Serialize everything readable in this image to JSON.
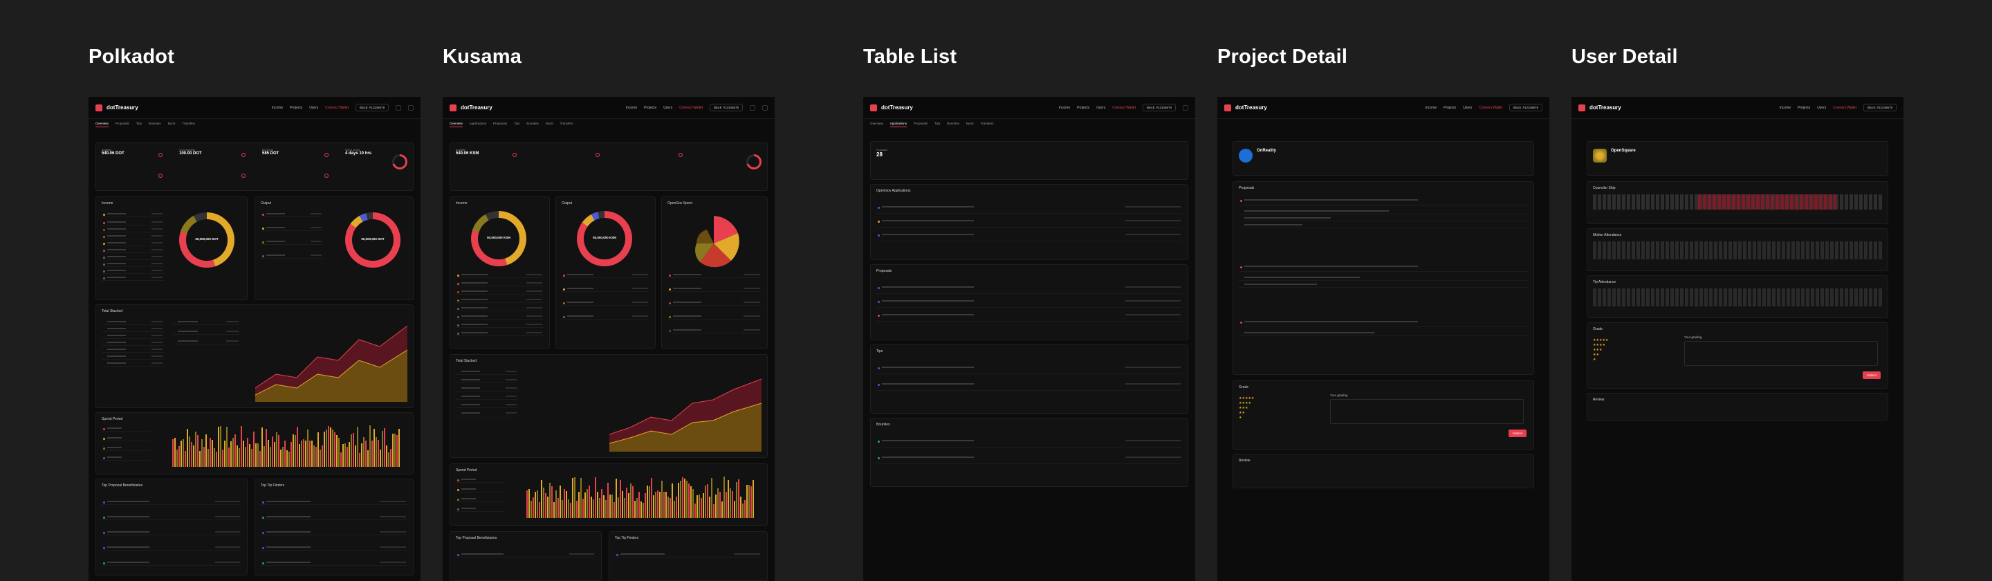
{
  "panels": [
    {
      "title": "Polkadot"
    },
    {
      "title": "Kusama"
    },
    {
      "title": "Table List"
    },
    {
      "title": "Project Detail"
    },
    {
      "title": "User Detail"
    }
  ],
  "app": {
    "logo_text": "dotTreasury",
    "nav": [
      "Income",
      "Projects",
      "Users",
      "Connect Wallet"
    ],
    "wallet": "Block: #12345678"
  },
  "polkadot": {
    "tabs": [
      "Overview",
      "Proposals",
      "Tips",
      "Bounties",
      "Burnt",
      "Transfers"
    ],
    "stats": [
      {
        "label": "Available",
        "value": "540.06 DOT"
      },
      {
        "label": "To be awarded",
        "value": "100.00 DOT"
      },
      {
        "label": "Burnt total",
        "value": "585 DOT"
      },
      {
        "label": "Spend period",
        "value": "4 days 10 hrs"
      }
    ],
    "cards": [
      "Income",
      "Output",
      "Total Stacked",
      "Spend Period",
      "Top Proposal Beneficiaries",
      "Top Tip Finders"
    ],
    "donut_value": "50,000,000 DOT"
  },
  "kusama": {
    "tabs": [
      "Overview",
      "Applications",
      "Proposals",
      "Tips",
      "Bounties",
      "Burnt",
      "Transfers"
    ],
    "cards": [
      "Income",
      "Output",
      "OpenGov Spent",
      "Total Stacked",
      "Spend Period",
      "Top Proposal Beneficiaries",
      "Top Tip Finders"
    ],
    "donut_value": "50,000,000 KSM"
  },
  "table_list": {
    "sections": [
      "OpenGov Applications",
      "Proposals",
      "Tips",
      "Bounties"
    ],
    "count": "28"
  },
  "project_detail": {
    "name": "OnReality",
    "section": "Proposals",
    "grade_label": "Grade",
    "your_grade": "Your grading",
    "submit": "Submit",
    "review": "Review"
  },
  "user_detail": {
    "name": "OpenSquare",
    "sections": [
      "Councilor Ship",
      "Motion Attendance",
      "Tip Attendance",
      "Grade",
      "Review"
    ],
    "submit": "Submit"
  },
  "colors": {
    "accent": "#e8404f",
    "gold": "#e3a92a",
    "olive": "#8a7a1e",
    "bg": "#1e1e1e",
    "frame": "#0c0c0c"
  }
}
